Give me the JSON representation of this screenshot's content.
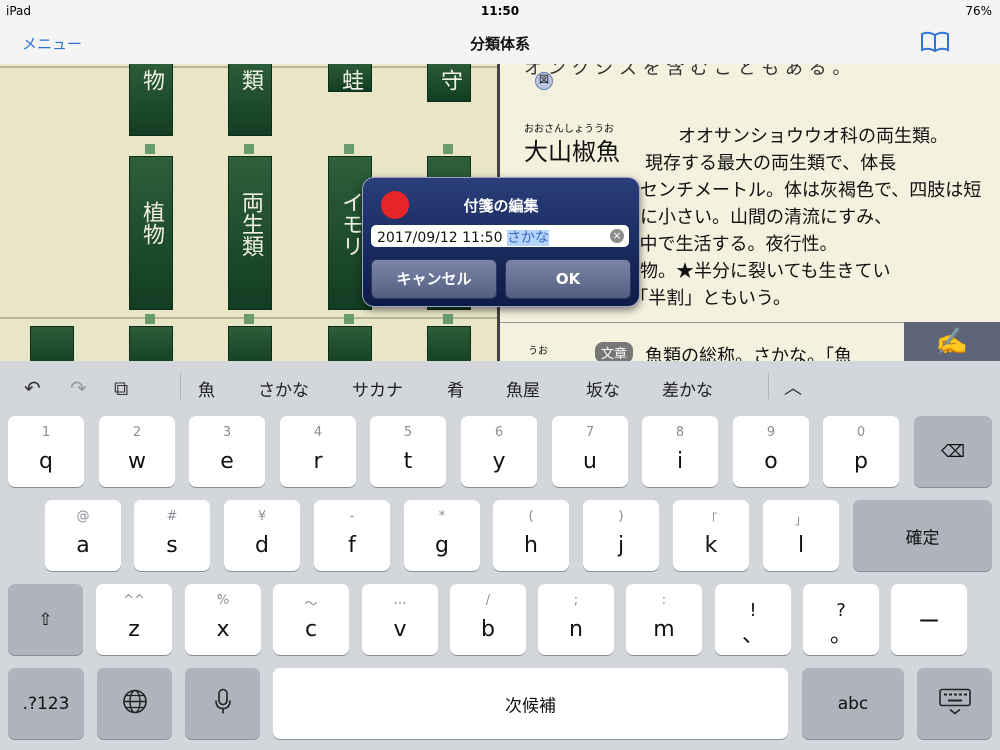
{
  "status": {
    "device": "iPad",
    "time": "11:50",
    "battery": "76%"
  },
  "nav": {
    "menu": "メニュー",
    "title": "分類体系",
    "book_icon": "book-icon"
  },
  "left_tiles": [
    {
      "label": "植物"
    },
    {
      "label": "両生類"
    },
    {
      "label": "イモリ"
    }
  ],
  "left_top_tiles": [
    {
      "label": "物"
    },
    {
      "label": "類"
    },
    {
      "label": "蛙"
    },
    {
      "label": "守"
    }
  ],
  "article": {
    "topline": "オ ン ク シ ス を 含 む こ と も あ る 。",
    "fig_badge": "図",
    "headword_ruby": "おおさんしょううお",
    "headword": "大山椒魚",
    "lines": [
      "オオサンショウウオ科の両生類。",
      "現存する最大の両生類で、体長",
      "六〇～一三〇センチメートル。体は灰褐色で、四肢は短",
      "く、目が非常に小さい。山間の清流にすみ、",
      "ほとんどを水中で生活する。夜行性。",
      "特別天然記念物。★半分に裂いても生きてい",
      "るといわれ、「半割」ともいう。"
    ],
    "next_ruby": "うお",
    "next_badge": "文章",
    "next_def": "魚類の総称。さかな。「魚"
  },
  "dialog": {
    "title": "付箋の編集",
    "field_prefix": "2017/09/12 11:50 ",
    "field_selected": "さかな",
    "cancel": "キャンセル",
    "ok": "OK"
  },
  "keyboard": {
    "candidates": [
      "魚",
      "さかな",
      "サカナ",
      "肴",
      "魚屋",
      "坂な",
      "差かな"
    ],
    "row1": [
      {
        "sub": "1",
        "main": "q"
      },
      {
        "sub": "2",
        "main": "w"
      },
      {
        "sub": "3",
        "main": "e"
      },
      {
        "sub": "4",
        "main": "r"
      },
      {
        "sub": "5",
        "main": "t"
      },
      {
        "sub": "6",
        "main": "y"
      },
      {
        "sub": "7",
        "main": "u"
      },
      {
        "sub": "8",
        "main": "i"
      },
      {
        "sub": "9",
        "main": "o"
      },
      {
        "sub": "0",
        "main": "p"
      }
    ],
    "row2": [
      {
        "sub": "@",
        "main": "a"
      },
      {
        "sub": "#",
        "main": "s"
      },
      {
        "sub": "¥",
        "main": "d"
      },
      {
        "sub": "-",
        "main": "f"
      },
      {
        "sub": "*",
        "main": "g"
      },
      {
        "sub": "(",
        "main": "h"
      },
      {
        "sub": ")",
        "main": "j"
      },
      {
        "sub": "「",
        "main": "k"
      },
      {
        "sub": "」",
        "main": "l"
      }
    ],
    "row3": [
      {
        "sub": "^^",
        "main": "z"
      },
      {
        "sub": "%",
        "main": "x"
      },
      {
        "sub": "〜",
        "main": "c"
      },
      {
        "sub": "…",
        "main": "v"
      },
      {
        "sub": "/",
        "main": "b"
      },
      {
        "sub": ";",
        "main": "n"
      },
      {
        "sub": ":",
        "main": "m"
      },
      {
        "sub": "!",
        "main": "、"
      },
      {
        "sub": "?",
        "main": "。"
      }
    ],
    "confirm": "確定",
    "dash": "ー",
    "numbers": ".?123",
    "space": "次候補",
    "abc": "abc"
  }
}
